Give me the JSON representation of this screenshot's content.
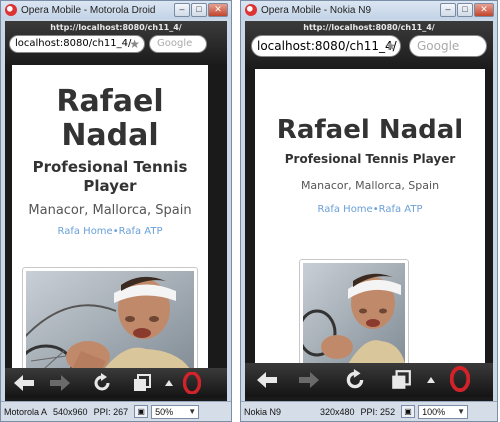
{
  "left_window": {
    "title": "Opera Mobile - Motorola Droid",
    "url_caption": "http://localhost:8080/ch11_4/",
    "url_value": "localhost:8080/ch11_4/",
    "search_placeholder": "Google",
    "page": {
      "heading_line1": "Rafael",
      "heading_line2": "Nadal",
      "subheading_line1": "Profesional Tennis",
      "subheading_line2": "Player",
      "location": "Manacor, Mallorca, Spain",
      "link_home": "Rafa Home",
      "separator": "•",
      "link_atp": "Rafa ATP"
    },
    "status": {
      "device": "Motorola A",
      "resolution": "540x960",
      "ppi": "PPI: 267",
      "zoom": "50%"
    }
  },
  "right_window": {
    "title": "Opera Mobile - Nokia N9",
    "url_caption": "http://localhost:8080/ch11_4/",
    "url_value": "localhost:8080/ch11_4/",
    "search_placeholder": "Google",
    "page": {
      "heading": "Rafael Nadal",
      "subheading": "Profesional Tennis Player",
      "location": "Manacor, Mallorca, Spain",
      "link_home": "Rafa Home",
      "separator": "•",
      "link_atp": "Rafa ATP"
    },
    "status": {
      "device": "Nokia N9",
      "resolution": "320x480",
      "ppi": "PPI: 252",
      "zoom": "100%"
    }
  },
  "window_controls": {
    "minimize": "–",
    "maximize": "□",
    "close": "✕"
  },
  "icons": [
    "back-arrow-icon",
    "forward-arrow-icon",
    "reload-icon",
    "tabs-icon",
    "up-arrow-icon",
    "opera-logo-icon",
    "star-icon",
    "screen-size-icon"
  ],
  "colors": {
    "link": "#6a9fd8",
    "opera_red": "#d2222a",
    "toolbar_dark": "#1e1e1e"
  }
}
